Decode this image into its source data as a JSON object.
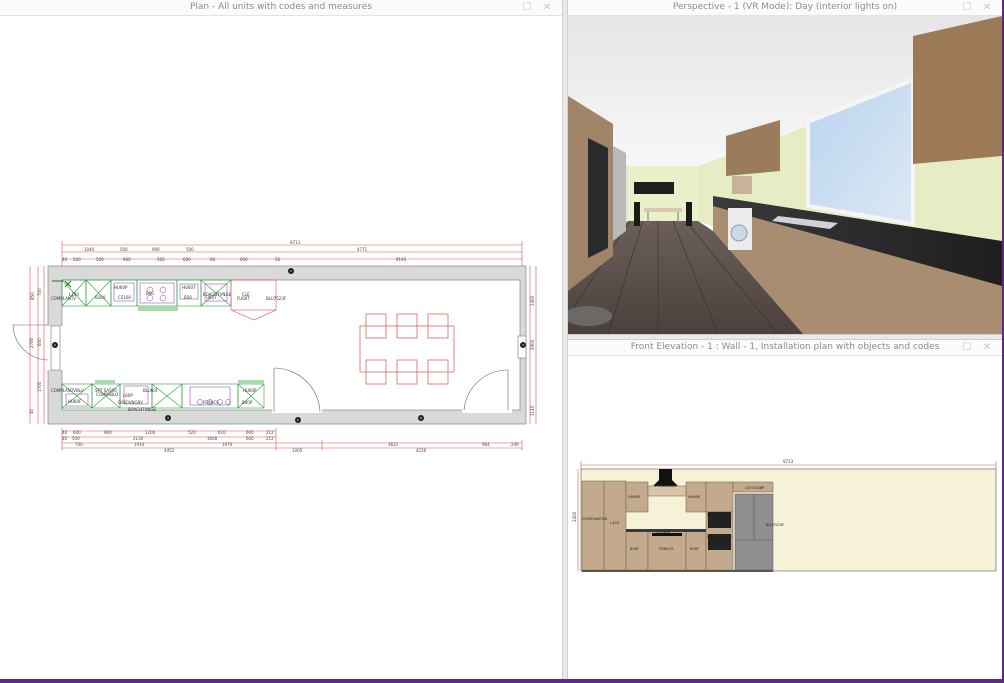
{
  "plan": {
    "title": "Plan - All units with codes and measures",
    "dims_top": [
      "9713",
      "1040",
      "500",
      "900",
      "500",
      "4771",
      "40",
      "500",
      "500",
      "900",
      "500",
      "600",
      "60",
      "600",
      "50",
      "9193"
    ],
    "dims_bottom": [
      "40",
      "600",
      "900",
      "1200",
      "520",
      "610",
      "600",
      "212",
      "40",
      "500",
      "2130",
      "1600",
      "600",
      "212",
      "700",
      "1910",
      "1970",
      "3622",
      "964",
      "246",
      "4452",
      "1005",
      "4226"
    ],
    "dims_left": [
      "850",
      "700",
      "2780",
      "600",
      "1700",
      "40"
    ],
    "dims_right": [
      "1460",
      "2900",
      "1145"
    ],
    "unit_codes_top": [
      "HU60P",
      "L100",
      "B100",
      "CS100",
      "HU60T",
      "B50",
      "COMPLANTV",
      "B60",
      "U60T",
      "FU60T",
      "BLU7523F",
      "BOACHTVNGE",
      "CLE"
    ],
    "unit_codes_bottom": [
      "COMPLANTVBLU",
      "SPT SA500",
      "COMPABLO",
      "BLU60F",
      "L60P",
      "DS60VNGRV",
      "HU60F",
      "HU60P",
      "FD60CS",
      "BOACHTVNGE",
      "B40P"
    ],
    "markers": [
      "1",
      "2",
      "3",
      "4",
      "5",
      "6"
    ]
  },
  "perspective": {
    "title": "Perspective - 1 (VR Mode): Day (interior lights on)"
  },
  "elevation": {
    "title": "Front Elevation - 1 : Wall - 1, Installation plan with objects and codes",
    "total_width": "9713",
    "height_dim": "2400",
    "unit_codes": [
      "COMPLANTVB",
      "L100",
      "HU60P",
      "FPC60D50S",
      "HU60P",
      "OCH1026P",
      "SUCCABCGM",
      "BLU7523F",
      "FS7NGE",
      "B50F",
      "B50F",
      "B40P",
      "FD60CS",
      "BOACHTVNGE"
    ]
  }
}
